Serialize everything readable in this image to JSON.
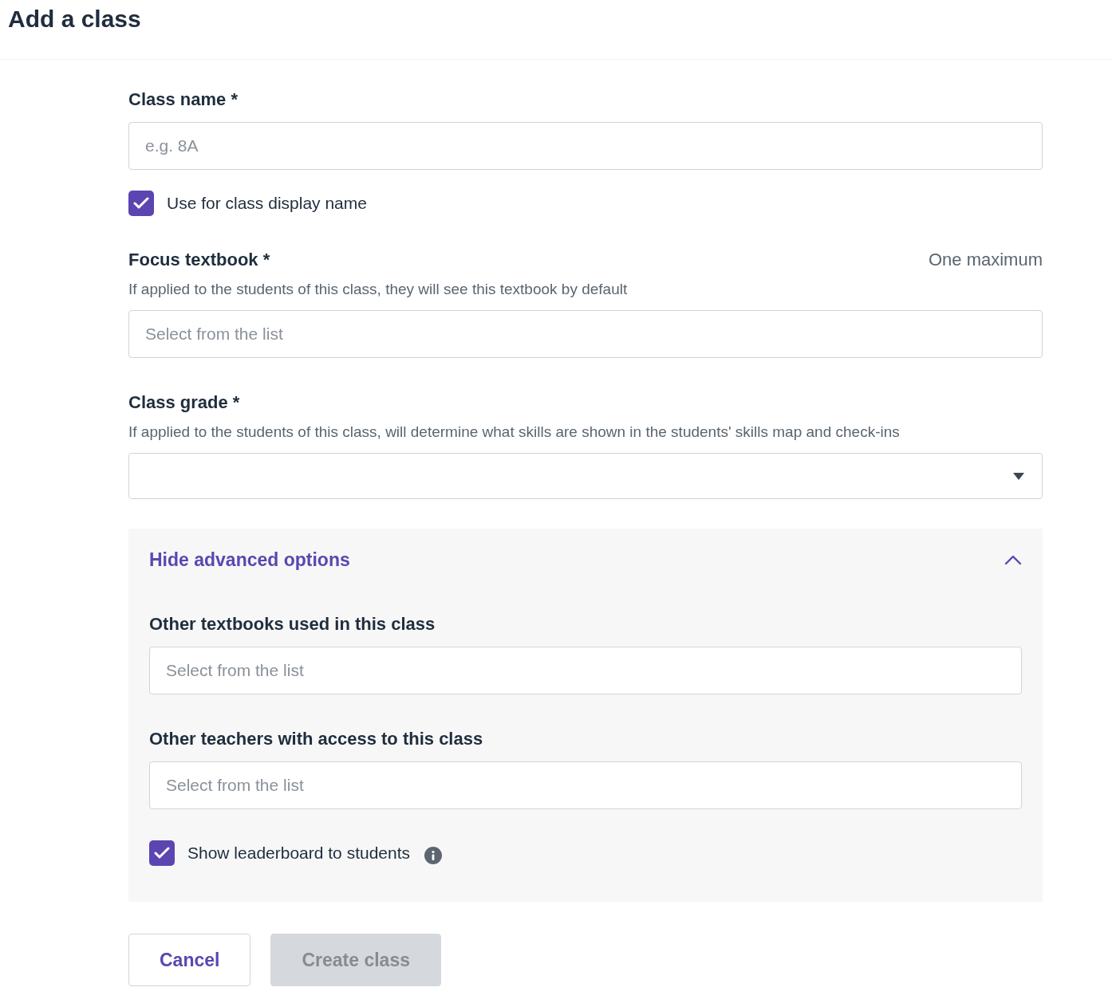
{
  "header": {
    "title": "Add a class"
  },
  "class_name": {
    "label": "Class name *",
    "placeholder": "e.g. 8A"
  },
  "display_name_checkbox": {
    "label": "Use for class display name",
    "checked": true
  },
  "focus_textbook": {
    "label": "Focus textbook *",
    "limit": "One maximum",
    "hint": "If applied to the students of this class, they will see this textbook by default",
    "placeholder": "Select from the list"
  },
  "class_grade": {
    "label": "Class grade *",
    "hint": "If applied to the students of this class, will determine what skills are shown in the students' skills map and check-ins"
  },
  "advanced": {
    "toggle_label": "Hide advanced options",
    "expanded": true,
    "fields": [
      {
        "label": "Other textbooks used in this class",
        "placeholder": "Select from the list"
      },
      {
        "label": "Other teachers with access to this class",
        "placeholder": "Select from the list"
      }
    ],
    "leaderboard_checkbox": {
      "label": "Show leaderboard to students",
      "checked": true
    }
  },
  "buttons": [
    {
      "label": "Cancel",
      "kind": "secondary",
      "disabled": false
    },
    {
      "label": "Create class",
      "kind": "primary",
      "disabled": true
    }
  ]
}
